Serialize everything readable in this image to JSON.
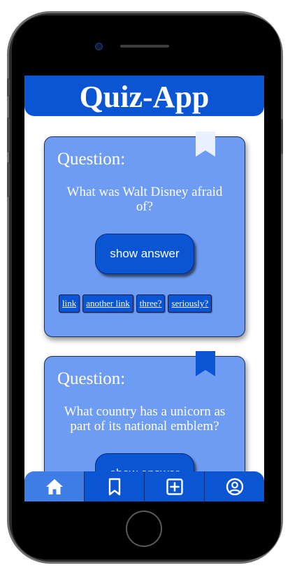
{
  "app": {
    "title": "Quiz-App"
  },
  "colors": {
    "primary": "#0a55d4",
    "card": "#6e9cf2",
    "nav_active": "#3e7ce6"
  },
  "cards": [
    {
      "label": "Question:",
      "question": "What was Walt Disney afraid of?",
      "button_label": "show answer",
      "bookmarked": false,
      "tags": [
        "link",
        "another link",
        "three?",
        "seriously?"
      ]
    },
    {
      "label": "Question:",
      "question": "What country has a unicorn as part of its national emblem?",
      "button_label": "show answer",
      "bookmarked": true,
      "tags": []
    }
  ],
  "nav": [
    {
      "icon": "home-icon",
      "active": true
    },
    {
      "icon": "bookmark-icon",
      "active": false
    },
    {
      "icon": "add-square-icon",
      "active": false
    },
    {
      "icon": "profile-icon",
      "active": false
    }
  ]
}
